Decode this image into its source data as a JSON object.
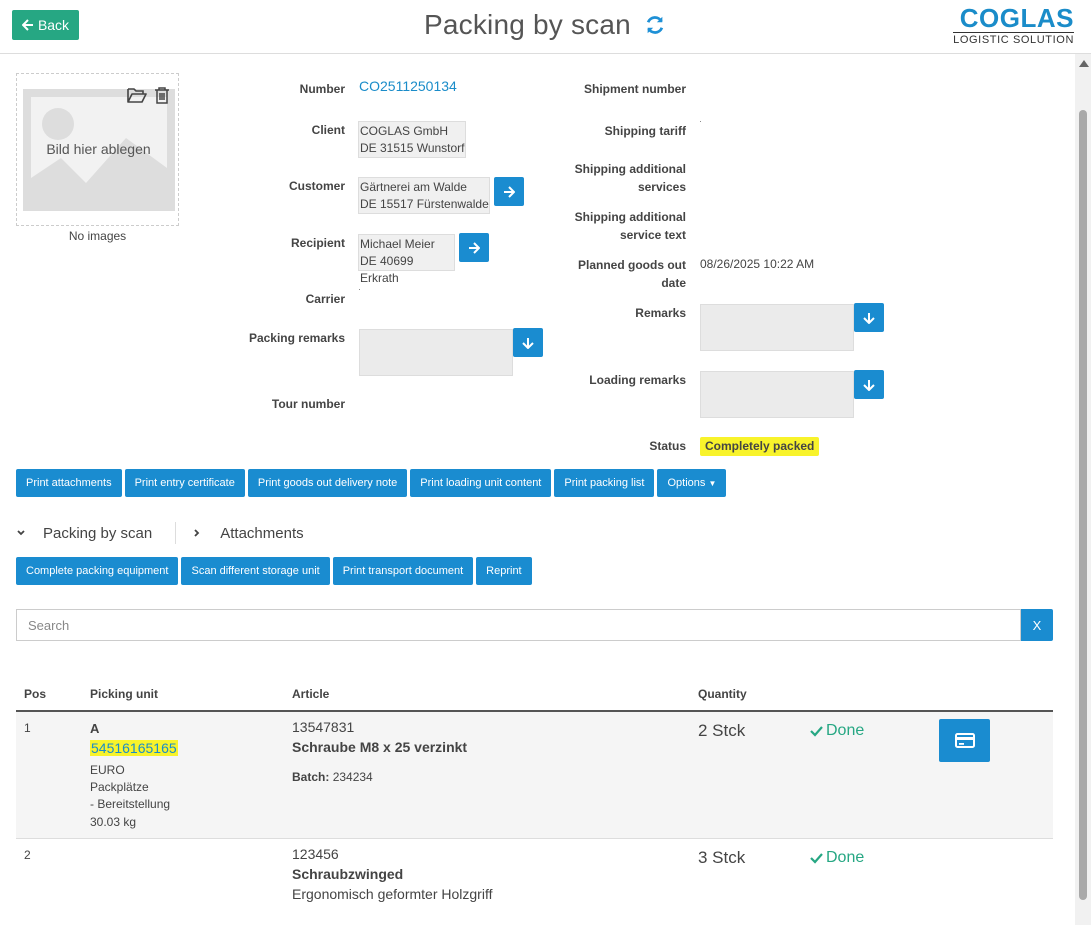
{
  "header": {
    "back_label": "Back",
    "title": "Packing by scan",
    "logo_main": "COGLAS",
    "logo_sub": "LOGISTIC SOLUTION"
  },
  "image_panel": {
    "dropzone_text": "Bild hier ablegen",
    "no_images": "No images"
  },
  "form": {
    "number_label": "Number",
    "number_value": "CO2511250134",
    "client_label": "Client",
    "client_line1": "COGLAS GmbH",
    "client_line2": "DE 31515 Wunstorf",
    "customer_label": "Customer",
    "customer_line1": "Gärtnerei am Walde",
    "customer_line2": "DE 15517 Fürstenwalde",
    "recipient_label": "Recipient",
    "recipient_line1": "Michael Meier",
    "recipient_line2": "DE 40699 Erkrath",
    "carrier_label": "Carrier",
    "packing_remarks_label": "Packing remarks",
    "tour_number_label": "Tour number",
    "shipment_number_label": "Shipment number",
    "shipping_tariff_label": "Shipping tariff",
    "shipping_add_services_l1": "Shipping additional",
    "shipping_add_services_l2": "services",
    "shipping_add_text_l1": "Shipping additional",
    "shipping_add_text_l2": "service text",
    "planned_out_l1": "Planned goods out",
    "planned_out_l2": "date",
    "planned_out_value": "08/26/2025 10:22 AM",
    "remarks_label": "Remarks",
    "loading_remarks_label": "Loading remarks",
    "status_label": "Status",
    "status_value": "Completely packed"
  },
  "actions": {
    "print_attachments": "Print attachments",
    "print_entry_certificate": "Print entry certificate",
    "print_goods_out_delivery_note": "Print goods out delivery note",
    "print_loading_unit_content": "Print loading unit content",
    "print_packing_list": "Print packing list",
    "options": "Options"
  },
  "tabs": {
    "packing_by_scan": "Packing by scan",
    "attachments": "Attachments"
  },
  "scan_actions": {
    "complete_packing_equipment": "Complete packing equipment",
    "scan_different_storage_unit": "Scan different storage unit",
    "print_transport_document": "Print transport document",
    "reprint": "Reprint"
  },
  "search": {
    "placeholder": "Search",
    "clear_label": "X"
  },
  "table": {
    "headers": {
      "pos": "Pos",
      "picking_unit": "Picking unit",
      "article": "Article",
      "quantity": "Quantity"
    },
    "rows": [
      {
        "pos": "1",
        "pu_code": "A",
        "pu_barcode": "54516165165",
        "pu_type": "EURO",
        "pu_location_l1": "Packplätze",
        "pu_location_l2": "- Bereitstellung",
        "pu_weight": "30.03 kg",
        "article_no": "13547831",
        "article_name": "Schraube M8 x 25 verzinkt",
        "batch_label": "Batch:",
        "batch_value": "234234",
        "quantity": "2 Stck",
        "status": "Done"
      },
      {
        "pos": "2",
        "article_no": "123456",
        "article_name": "Schraubzwinged",
        "article_desc": "Ergonomisch geformter Holzgriff",
        "quantity": "3 Stck",
        "status": "Done"
      }
    ]
  },
  "colors": {
    "primary": "#1a8cd0",
    "back": "#26a783",
    "highlight": "#f8f32b",
    "done": "#26a783"
  }
}
